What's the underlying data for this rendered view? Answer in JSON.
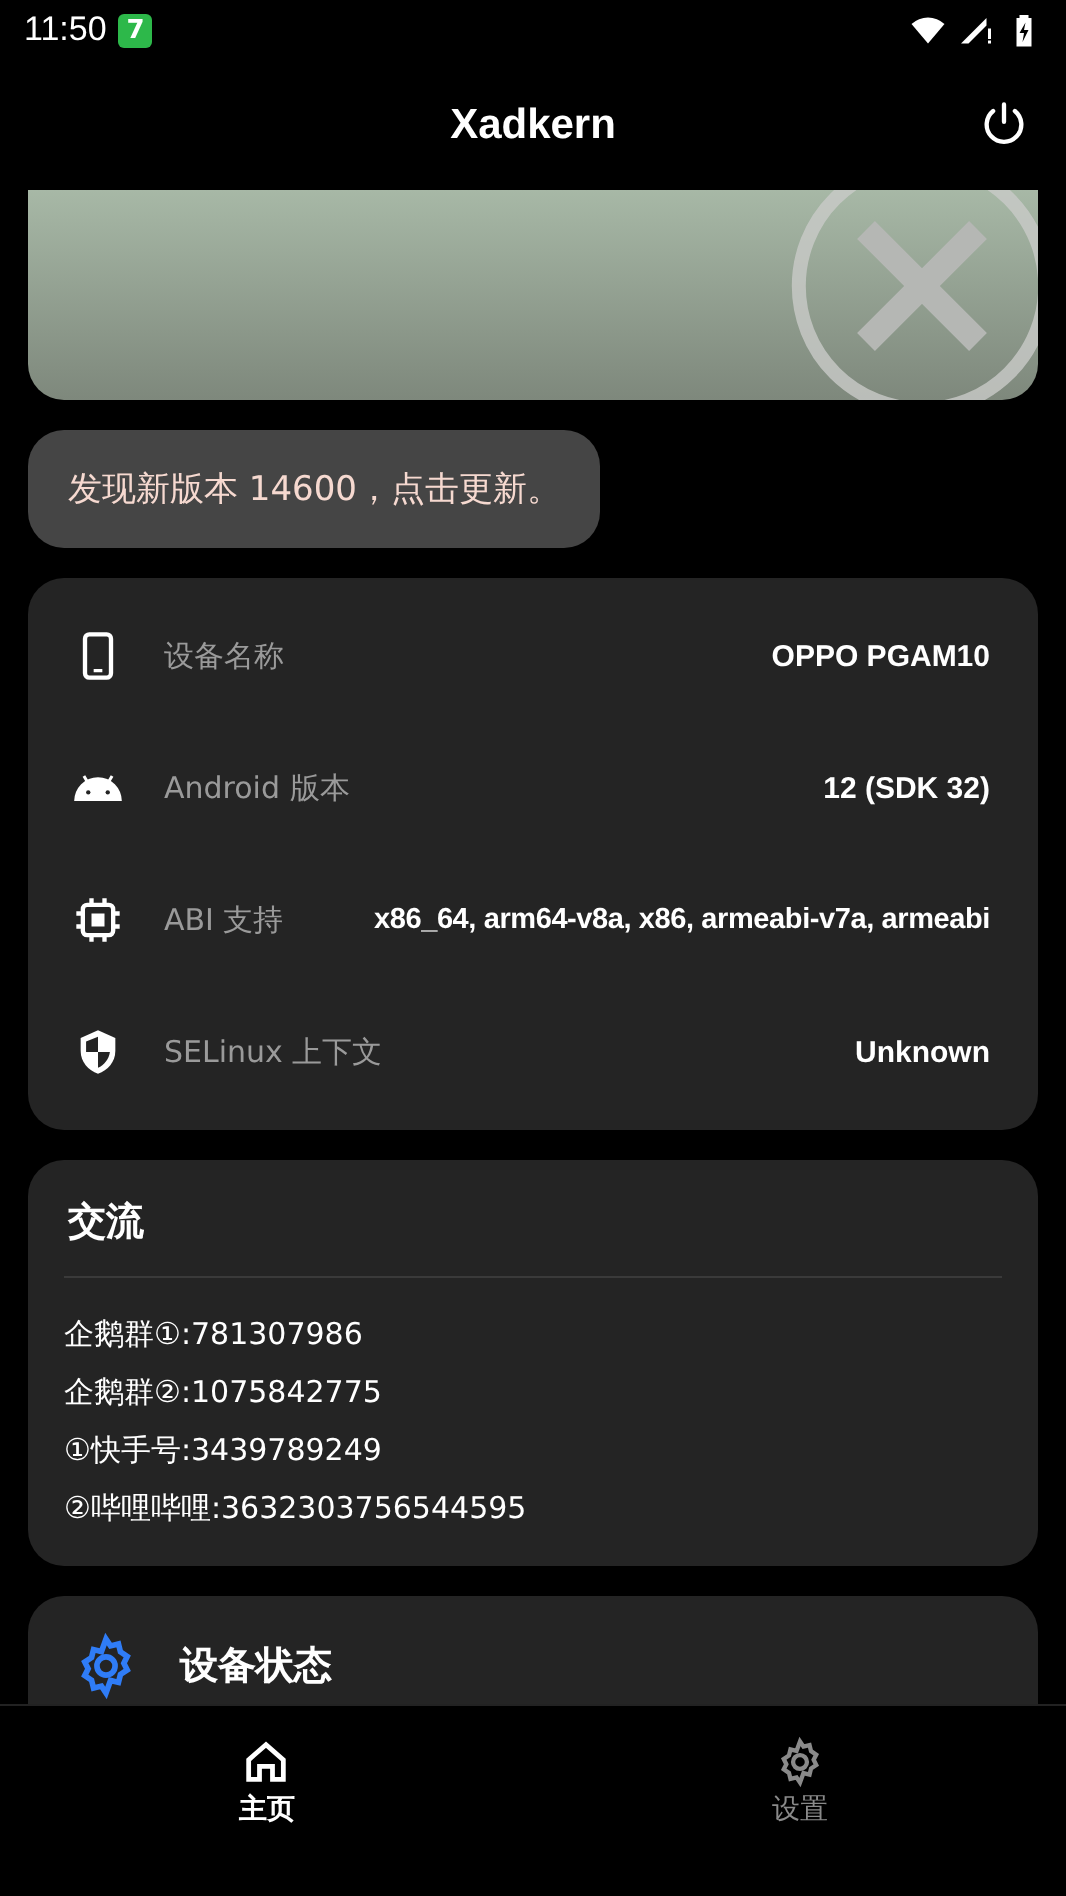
{
  "status_bar": {
    "time": "11:50",
    "notification_badge": "7"
  },
  "app_bar": {
    "title": "Xadkern"
  },
  "status_card": {
    "active": false
  },
  "update_notice": {
    "text": "发现新版本 14600，点击更新。"
  },
  "device_info": [
    {
      "kind": "phone",
      "label": "设备名称",
      "value": "OPPO PGAM10"
    },
    {
      "kind": "android",
      "label": "Android 版本",
      "value": "12 (SDK 32)"
    },
    {
      "kind": "chip",
      "label": "ABI 支持",
      "value": "x86_64, arm64-v8a, x86, armeabi-v7a, armeabi"
    },
    {
      "kind": "shield",
      "label": "SELinux 上下文",
      "value": "Unknown"
    }
  ],
  "community": {
    "title": "交流",
    "lines": [
      "企鹅群①:781307986",
      "企鹅群②:1075842775",
      "①快手号:3439789249",
      "②哔哩哔哩:3632303756544595"
    ]
  },
  "device_status": {
    "title": "设备状态"
  },
  "bottom_nav": [
    {
      "label": "主页",
      "kind": "home",
      "selected": true
    },
    {
      "label": "设置",
      "kind": "settings",
      "selected": false
    }
  ]
}
